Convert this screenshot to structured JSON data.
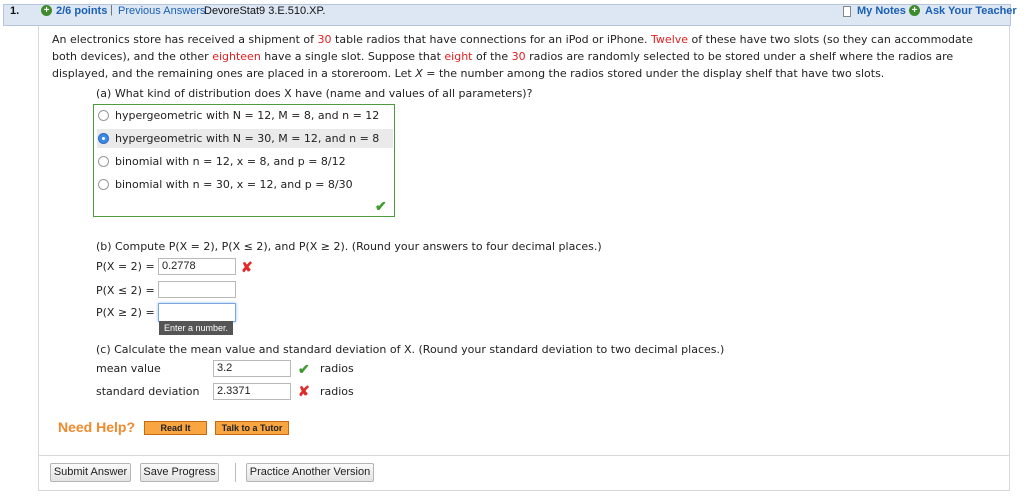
{
  "header": {
    "question_number": "1.",
    "points": "2/6 points",
    "separator": "|",
    "previous_answers": "Previous Answers",
    "code": "DevoreStat9 3.E.510.XP.",
    "my_notes": "My Notes",
    "ask_teacher": "Ask Your Teacher"
  },
  "stem": {
    "p1": "An electronics store has received a shipment of ",
    "n30": "30",
    "p2": " table radios that have connections for an iPod or iPhone. ",
    "twelve": "Twelve",
    "p3": " of these have two slots (so they can accommodate both devices), and the other ",
    "eighteen": "eighteen",
    "p4": " have a single slot. Suppose that ",
    "eight": "eight",
    "p5": " of the ",
    "n30b": "30",
    "p6": " radios are randomly selected to be stored under a shelf where the radios are displayed, and the remaining ones are placed in a storeroom. Let ",
    "X": "X",
    "p7": " = the number among the radios stored under the display shelf that have two slots."
  },
  "part_a": {
    "question": "(a) What kind of distribution does X have (name and values of all parameters)?",
    "options": [
      {
        "label": "hypergeometric with N = 12, M = 8, and n = 12",
        "selected": false
      },
      {
        "label": "hypergeometric with N = 30, M = 12, and n = 8",
        "selected": true
      },
      {
        "label": "binomial with n = 12, x = 8, and p = 8/12",
        "selected": false
      },
      {
        "label": "binomial with n = 30, x = 12, and p = 8/30",
        "selected": false
      }
    ],
    "status_icon": "check-icon"
  },
  "part_b": {
    "question": "(b) Compute P(X = 2), P(X ≤ 2), and P(X ≥ 2). (Round your answers to four decimal places.)",
    "rows": [
      {
        "label": "P(X = 2) =",
        "value": "0.2778",
        "status": "x-icon"
      },
      {
        "label": "P(X ≤ 2) =",
        "value": "",
        "status": ""
      },
      {
        "label": "P(X ≥ 2) =",
        "value": "",
        "status": ""
      }
    ],
    "tooltip": "Enter a number."
  },
  "part_c": {
    "question": "(c) Calculate the mean value and standard deviation of X. (Round your standard deviation to two decimal places.)",
    "rows": [
      {
        "label": "mean value",
        "value": "3.2",
        "unit": "radios",
        "status": "check-icon"
      },
      {
        "label": "standard deviation",
        "value": "2.3371",
        "unit": "radios",
        "status": "x-icon"
      }
    ]
  },
  "help": {
    "title": "Need Help?",
    "read_it": "Read It",
    "tutor": "Talk to a Tutor"
  },
  "buttons": {
    "submit": "Submit Answer",
    "save": "Save Progress",
    "practice": "Practice Another Version"
  }
}
